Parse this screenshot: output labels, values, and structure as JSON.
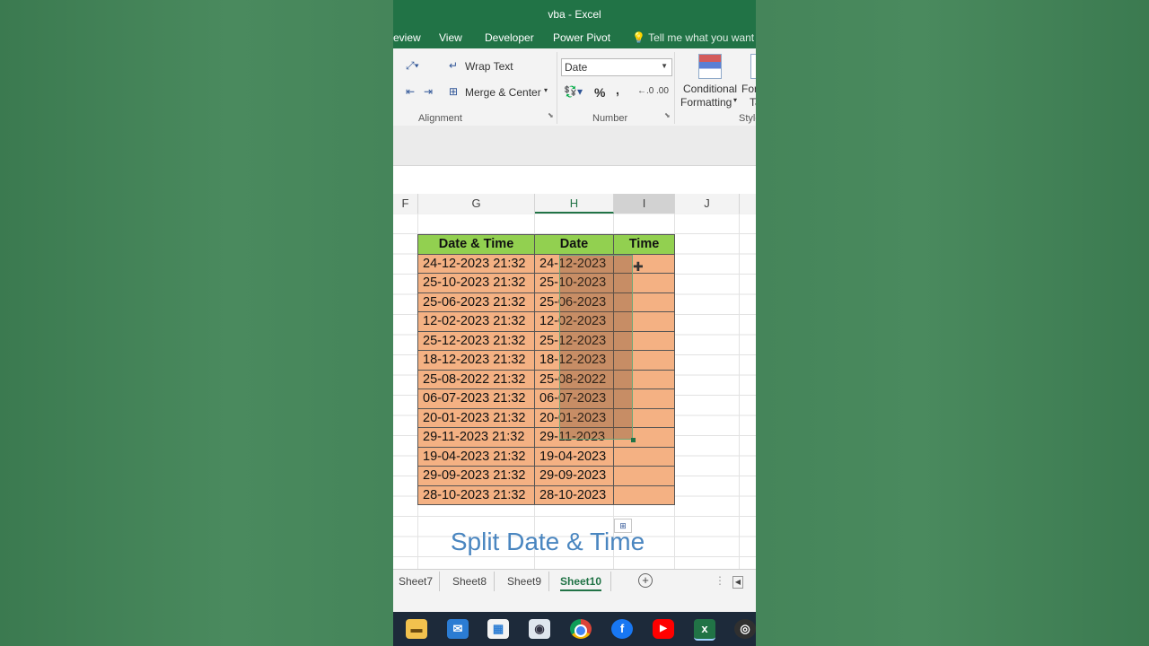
{
  "window": {
    "title": "vba - Excel"
  },
  "ribbon_tabs": [
    "eview",
    "View",
    "Developer",
    "Power Pivot"
  ],
  "tell_me": "Tell me what you want to",
  "alignment": {
    "wrap_text": "Wrap Text",
    "merge_center": "Merge & Center",
    "group_label": "Alignment"
  },
  "number": {
    "format_value": "Date",
    "percent": "%",
    "comma": ",",
    "group_label": "Number"
  },
  "styles": {
    "conditional_line1": "Conditional",
    "conditional_line2": "Formatting",
    "format_partial": "For",
    "format_partial2": "Ta",
    "group_label": "Style"
  },
  "columns": [
    "F",
    "G",
    "H",
    "I",
    "J"
  ],
  "table": {
    "headers": [
      "Date & Time",
      "Date",
      "Time"
    ],
    "rows": [
      [
        "24-12-2023 21:32",
        "24-12-2023",
        ""
      ],
      [
        "25-10-2023 21:32",
        "25-10-2023",
        ""
      ],
      [
        "25-06-2023 21:32",
        "25-06-2023",
        ""
      ],
      [
        "12-02-2023 21:32",
        "12-02-2023",
        ""
      ],
      [
        "25-12-2023 21:32",
        "25-12-2023",
        ""
      ],
      [
        "18-12-2023 21:32",
        "18-12-2023",
        ""
      ],
      [
        "25-08-2022 21:32",
        "25-08-2022",
        ""
      ],
      [
        "06-07-2023 21:32",
        "06-07-2023",
        ""
      ],
      [
        "20-01-2023 21:32",
        "20-01-2023",
        ""
      ],
      [
        "29-11-2023 21:32",
        "29-11-2023",
        ""
      ],
      [
        "19-04-2023 21:32",
        "19-04-2023",
        ""
      ],
      [
        "29-09-2023 21:32",
        "29-09-2023",
        ""
      ],
      [
        "28-10-2023 21:32",
        "28-10-2023",
        ""
      ]
    ]
  },
  "caption": "Split Date & Time",
  "sheets": [
    "Sheet7",
    "Sheet8",
    "Sheet9",
    "Sheet10"
  ],
  "active_sheet": "Sheet10",
  "taskbar_icons": [
    "file-explorer-icon",
    "mail-icon",
    "store-icon",
    "media-icon",
    "chrome-icon",
    "facebook-icon",
    "youtube-icon",
    "excel-icon",
    "obs-icon"
  ],
  "colors": {
    "excel_green": "#217346",
    "header_fill": "#92d050",
    "cell_fill": "#f4b183",
    "caption": "#4a86c0"
  }
}
